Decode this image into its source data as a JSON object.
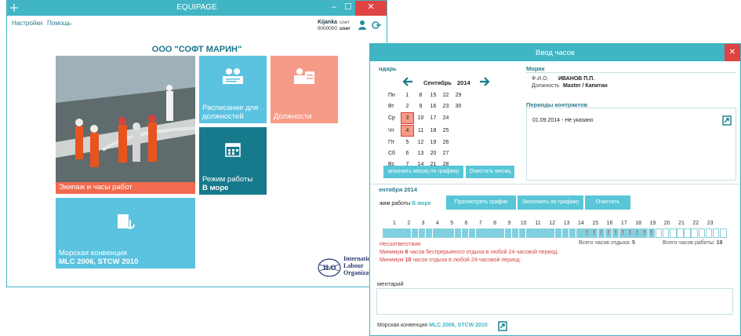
{
  "main_window": {
    "title": "EQUIPAGE",
    "controls": {
      "minimize": "–",
      "maximize": "☐",
      "close": "✕"
    },
    "menu": [
      "Настройки",
      "Помощь"
    ],
    "user": {
      "name": "Kijanka",
      "code": "0000000",
      "role_top": "user",
      "role_bottom": "user"
    },
    "company": "ООО \"СОФТ МАРИН\"",
    "tiles": {
      "crew": {
        "label": "Экипаж и часы работ"
      },
      "schedule": {
        "label": "Расписание для должностей"
      },
      "positions": {
        "label": "Должности"
      },
      "work_mode": {
        "label": "Режим работы",
        "value": "В море"
      },
      "convention": {
        "label": "Морская конвенция",
        "value": "MLC 2006, STCW 2010"
      }
    },
    "ilo": {
      "abbr": "ILO",
      "line1": "International",
      "line2": "Labour",
      "line3": "Organization"
    },
    "colors": {
      "teal": "#40b5c4",
      "orange": "#f06b4f",
      "salmon": "#f79b89",
      "dark_teal": "#17798c",
      "light_blue": "#59c1e0"
    }
  },
  "hours_window": {
    "title": "Ввод часов",
    "close": "✕",
    "calendar": {
      "header": "ндарь",
      "month": "Сентябрь",
      "year": "2014",
      "rows": [
        {
          "day": "Пн",
          "dates": [
            "1",
            "8",
            "15",
            "22",
            "29"
          ]
        },
        {
          "day": "Вт",
          "dates": [
            "2",
            "9",
            "16",
            "23",
            "30"
          ]
        },
        {
          "day": "Ср",
          "dates": [
            "3",
            "10",
            "17",
            "24",
            ""
          ]
        },
        {
          "day": "Чт",
          "dates": [
            "4",
            "11",
            "18",
            "25",
            ""
          ]
        },
        {
          "day": "Пт",
          "dates": [
            "5",
            "12",
            "19",
            "26",
            ""
          ]
        },
        {
          "day": "Сб",
          "dates": [
            "6",
            "13",
            "20",
            "27",
            ""
          ]
        },
        {
          "day": "Вс",
          "dates": [
            "7",
            "14",
            "21",
            "28",
            ""
          ]
        }
      ],
      "highlighted": [
        "3",
        "4"
      ],
      "btn_fill": "аполнить месяц по графику",
      "btn_clear": "Очистить месяц"
    },
    "sailor": {
      "header": "Моряк",
      "fio_label": "Ф.И.О.",
      "fio_value": "ИВАНОВ П.П.",
      "position_label": "Должность",
      "position_value": "Master / Капитан"
    },
    "contracts": {
      "header": "Периоды контрактов",
      "item": "01.09.2014 - Не указано"
    },
    "date_header": "ентября 2014",
    "mode": {
      "label": "жим работы",
      "value": "В море"
    },
    "buttons": [
      "Просмотреть график",
      "Заполнить по графику",
      "Очистить"
    ],
    "hours": [
      "1",
      "2",
      "3",
      "4",
      "5",
      "6",
      "7",
      "8",
      "9",
      "10",
      "11",
      "12",
      "13",
      "14",
      "15",
      "16",
      "17",
      "18",
      "19",
      "20",
      "21",
      "22",
      "23"
    ],
    "mark": "!",
    "rest_label": "Всего часов отдыха:",
    "rest_value": "5",
    "work_label": "Всего часов работы:",
    "work_value": "19",
    "violations_title": "Несоответствия:",
    "violations": [
      {
        "pre": "Минимум ",
        "num": "6",
        "post": " часов беспрерывного отдыха в любой 24-часовой период."
      },
      {
        "pre": "Минимум ",
        "num": "10",
        "post": " часов отдыха в любой 24-часовой период."
      }
    ],
    "comment_label": "ментарий",
    "footer_label": "Морская конвенция",
    "footer_value": "MLC 2006, STCW 2010"
  }
}
